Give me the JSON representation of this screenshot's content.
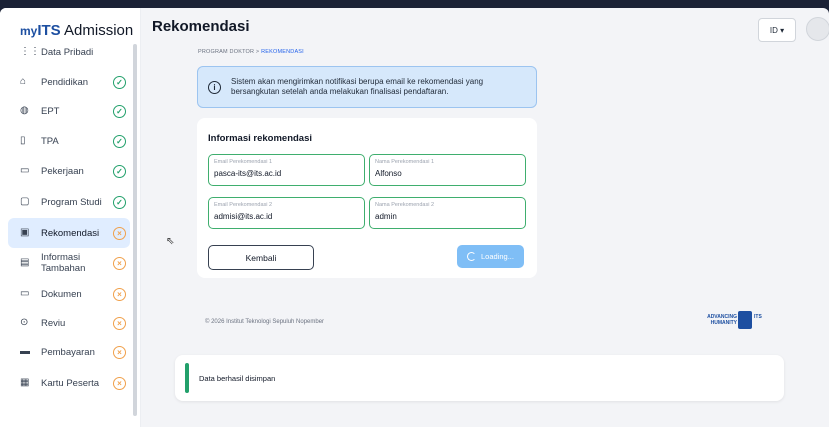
{
  "app": {
    "brand_prefix": "my",
    "brand_its": "ITS",
    "brand_suffix": " Admission"
  },
  "header": {
    "title": "Rekomendasi",
    "language": "ID ▾"
  },
  "sidebar": {
    "items": [
      {
        "label": "Data Pribadi",
        "status": "none",
        "icon": "grid-icon"
      },
      {
        "label": "Pendidikan",
        "status": "ok",
        "icon": "graduation-cap-icon"
      },
      {
        "label": "EPT",
        "status": "ok",
        "icon": "globe-icon"
      },
      {
        "label": "TPA",
        "status": "ok",
        "icon": "document-icon"
      },
      {
        "label": "Pekerjaan",
        "status": "ok",
        "icon": "briefcase-icon"
      },
      {
        "label": "Program Studi",
        "status": "ok",
        "icon": "program-icon"
      },
      {
        "label": "Rekomendasi",
        "status": "no",
        "icon": "recommendation-icon"
      },
      {
        "label": "Informasi\nTambahan",
        "status": "no",
        "icon": "info-doc-icon"
      },
      {
        "label": "Dokumen",
        "status": "no",
        "icon": "folder-icon"
      },
      {
        "label": "Reviu",
        "status": "no",
        "icon": "search-icon"
      },
      {
        "label": "Pembayaran",
        "status": "no",
        "icon": "card-icon"
      },
      {
        "label": "Kartu Peserta",
        "status": "no",
        "icon": "id-card-icon"
      }
    ]
  },
  "breadcrumb": {
    "parent": "PROGRAM DOKTOR",
    "separator": " > ",
    "current": "REKOMENDASI"
  },
  "alert": {
    "text": "Sistem akan mengirimkan notifikasi berupa email ke rekomendasi yang bersangkutan setelah anda melakukan finalisasi pendaftaran."
  },
  "form": {
    "title": "Informasi rekomendasi",
    "fields": [
      {
        "label": "Email Perekomendasi 1",
        "value": "pasca-its@its.ac.id"
      },
      {
        "label": "Nama Perekomendasi 1",
        "value": "Alfonso"
      },
      {
        "label": "Email Perekomendasi 2",
        "value": "admisi@its.ac.id"
      },
      {
        "label": "Nama Perekomendasi 2",
        "value": "admin"
      }
    ],
    "back_label": "Kembali",
    "loading_label": "Loading..."
  },
  "footer": {
    "copyright": "© 2026 Institut Teknologi Sepuluh Nopember",
    "logo_text_1": "ADVANCING",
    "logo_text_2": "HUMANITY",
    "logo_its": "ITS"
  },
  "toast": {
    "message": "Data berhasil disimpan"
  },
  "colors": {
    "accent": "#2563eb",
    "success": "#22a06b",
    "pending": "#f0a04b",
    "alert_bg": "#d6e8fb"
  }
}
